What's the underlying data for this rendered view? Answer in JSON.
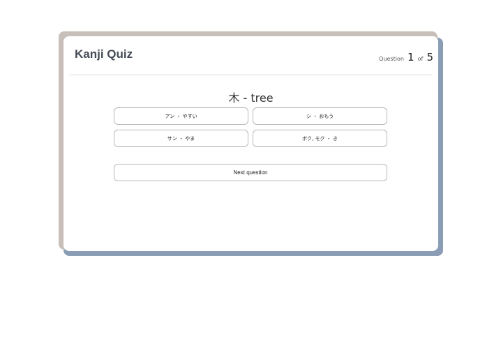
{
  "app": {
    "title": "Kanji Quiz"
  },
  "counter": {
    "label": "Question",
    "current": "1",
    "of_label": "of",
    "total": "5"
  },
  "question": {
    "text": "木 - tree"
  },
  "answers": [
    {
      "label": "アン ・ やすい"
    },
    {
      "label": "シ ・ おもう"
    },
    {
      "label": "サン ・ やま"
    },
    {
      "label": "ボク, モク ・ き"
    }
  ],
  "actions": {
    "next_label": "Next question"
  },
  "colors": {
    "title": "#444b55",
    "back_layer_tan": "#c8bfb8",
    "back_layer_blue": "#8a9db5",
    "button_border": "#b8b8b8"
  }
}
